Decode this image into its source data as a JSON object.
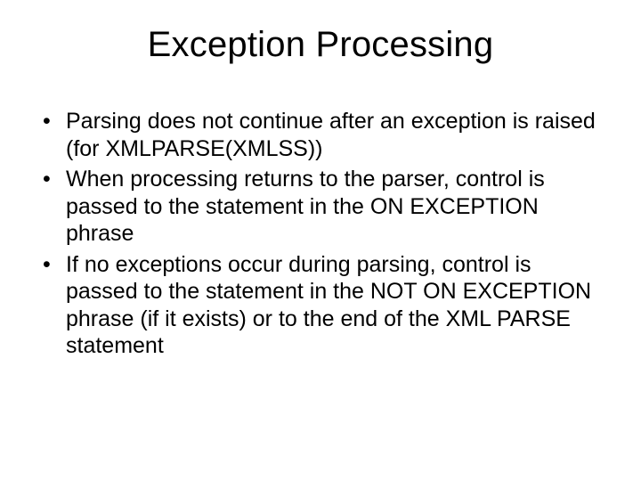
{
  "slide": {
    "title": "Exception Processing",
    "bullets": [
      "Parsing does not continue after an exception is raised (for XMLPARSE(XMLSS))",
      "When processing returns to the parser, control is passed to the statement in the ON EXCEPTION phrase",
      "If no exceptions occur during parsing, control is passed to the statement in the NOT ON EXCEPTION phrase (if it exists) or to the end of the XML PARSE statement"
    ]
  }
}
